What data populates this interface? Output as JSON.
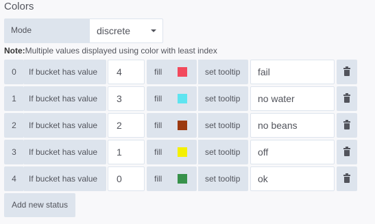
{
  "section": {
    "title": "Colors"
  },
  "mode": {
    "label": "Mode",
    "value": "discrete"
  },
  "note": {
    "bold": "Note:",
    "text": "Multiple values displayed using color with least index"
  },
  "rules": [
    {
      "index": "0",
      "condition": "If bucket has value",
      "value": "4",
      "fill_label": "fill",
      "color": "#f2495c",
      "tooltip_label": "set tooltip",
      "tooltip": "fail"
    },
    {
      "index": "1",
      "condition": "If bucket has value",
      "value": "3",
      "fill_label": "fill",
      "color": "#5ee4f0",
      "tooltip_label": "set tooltip",
      "tooltip": "no water"
    },
    {
      "index": "2",
      "condition": "If bucket has value",
      "value": "2",
      "fill_label": "fill",
      "color": "#9c3a10",
      "tooltip_label": "set tooltip",
      "tooltip": "no beans"
    },
    {
      "index": "3",
      "condition": "If bucket has value",
      "value": "1",
      "fill_label": "fill",
      "color": "#f4f000",
      "tooltip_label": "set tooltip",
      "tooltip": "off"
    },
    {
      "index": "4",
      "condition": "If bucket has value",
      "value": "0",
      "fill_label": "fill",
      "color": "#37924b",
      "tooltip_label": "set tooltip",
      "tooltip": "ok"
    }
  ],
  "add_button": {
    "label": "Add new status"
  },
  "icons": {
    "delete": "trash-icon",
    "dropdown": "chevron-down-icon"
  }
}
